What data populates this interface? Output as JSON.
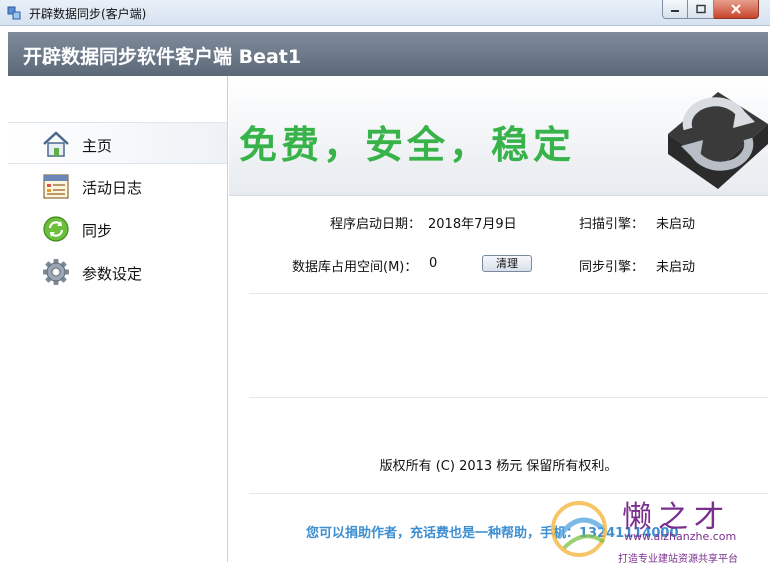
{
  "window": {
    "title": "开辟数据同步(客户端)"
  },
  "header": {
    "title": "开辟数据同步软件客户端 Beat1"
  },
  "sidebar": {
    "items": [
      {
        "label": "主页",
        "icon": "home-icon"
      },
      {
        "label": "活动日志",
        "icon": "calendar-log-icon"
      },
      {
        "label": "同步",
        "icon": "sync-icon"
      },
      {
        "label": "参数设定",
        "icon": "gear-icon"
      }
    ],
    "active_index": 0
  },
  "banner": {
    "slogan": "免费，安全，稳定",
    "slogan_color": "#37b34a"
  },
  "info": {
    "start_date_label": "程序启动日期：",
    "start_date_value": "2018年7月9日",
    "scan_engine_label": "扫描引擎：",
    "scan_engine_value": "未启动",
    "db_space_label": "数据库占用空间(M)：",
    "db_space_value": "0",
    "clear_button": "清理",
    "sync_engine_label": "同步引擎：",
    "sync_engine_value": "未启动"
  },
  "footer": {
    "copyright": "版权所有 (C) 2013 杨元 保留所有权利。",
    "donate": "您可以捐助作者，充话费也是一种帮助，手机：13241114000"
  },
  "watermark": {
    "brand": "懒之才",
    "url": "www.aizhanzhe.com",
    "slogan": "打造专业建站资源共享平台"
  },
  "colors": {
    "header_bg": "#6b7989",
    "donate_text": "#3d8fd1",
    "watermark": "#7a2f8f"
  }
}
